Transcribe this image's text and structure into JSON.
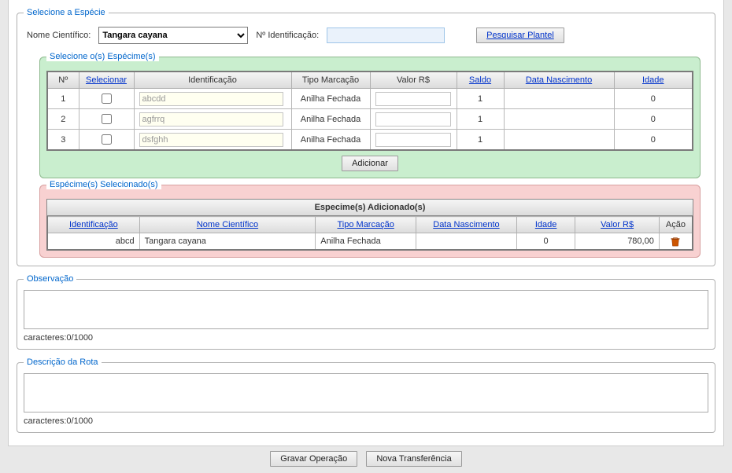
{
  "especie": {
    "legend": "Selecione a Espécie",
    "nome_label": "Nome Científico:",
    "nome_value": "Tangara cayana",
    "id_label": "Nº Identificação:",
    "id_value": "",
    "pesquisar_label": "Pesquisar Plantel"
  },
  "especimes": {
    "legend": "Selecione o(s) Espécime(s)",
    "headers": {
      "n": "Nº",
      "selecionar": "Selecionar",
      "identificacao": "Identificação",
      "tipo": "Tipo Marcação",
      "valor": "Valor R$",
      "saldo": "Saldo",
      "data": "Data Nascimento",
      "idade": "Idade"
    },
    "rows": [
      {
        "n": "1",
        "id": "abcdd",
        "tipo": "Anilha Fechada",
        "valor": "",
        "saldo": "1",
        "data": "",
        "idade": "0"
      },
      {
        "n": "2",
        "id": "agfrrq",
        "tipo": "Anilha Fechada",
        "valor": "",
        "saldo": "1",
        "data": "",
        "idade": "0"
      },
      {
        "n": "3",
        "id": "dsfghh",
        "tipo": "Anilha Fechada",
        "valor": "",
        "saldo": "1",
        "data": "",
        "idade": "0"
      }
    ],
    "adicionar_label": "Adicionar"
  },
  "selecionados": {
    "legend": "Espécime(s) Selecionado(s)",
    "title": "Especime(s) Adicionado(s)",
    "headers": {
      "identificacao": "Identificação",
      "nome": "Nome Científico",
      "tipo": "Tipo Marcação",
      "data": "Data Nascimento",
      "idade": "Idade",
      "valor": "Valor R$",
      "acao": "Ação"
    },
    "rows": [
      {
        "id": "abcd",
        "nome": "Tangara cayana",
        "tipo": "Anilha Fechada",
        "data": "",
        "idade": "0",
        "valor": "780,00"
      }
    ]
  },
  "observacao": {
    "legend": "Observação",
    "value": "",
    "count": "caracteres:0/1000"
  },
  "rota": {
    "legend": "Descrição da Rota",
    "value": "",
    "count": "caracteres:0/1000"
  },
  "footer": {
    "gravar": "Gravar Operação",
    "nova": "Nova Transferência"
  }
}
